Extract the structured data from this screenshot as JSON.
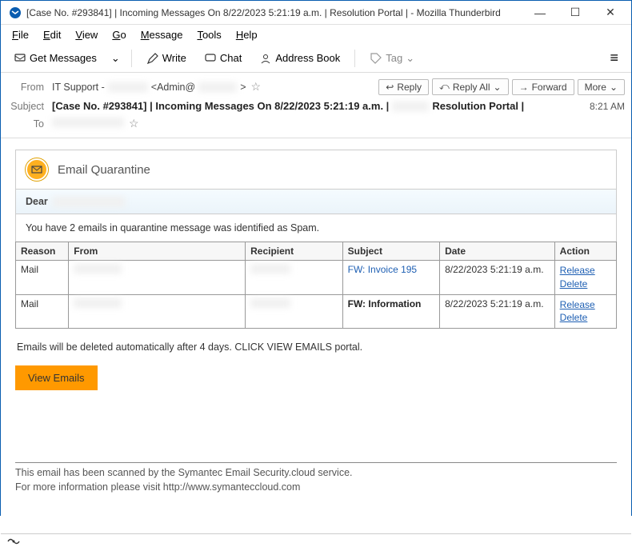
{
  "window": {
    "title": "[Case No. #293841] | Incoming Messages On 8/22/2023 5:21:19 a.m. |             Resolution Portal | - Mozilla Thunderbird"
  },
  "menu": [
    "File",
    "Edit",
    "View",
    "Go",
    "Message",
    "Tools",
    "Help"
  ],
  "toolbar": {
    "get_messages": "Get Messages",
    "write": "Write",
    "chat": "Chat",
    "address_book": "Address Book",
    "tag": "Tag"
  },
  "header": {
    "from_label": "From",
    "from_value": "IT Support -              <Admin@              >",
    "reply": "Reply",
    "reply_all": "Reply All",
    "forward": "Forward",
    "more": "More",
    "subject_label": "Subject",
    "subject_value": "[Case No. #293841] | Incoming Messages On 8/22/2023 5:21:19 a.m. |               Resolution Portal |",
    "time": "8:21 AM",
    "to_label": "To"
  },
  "body": {
    "quarantine_title": "Email Quarantine",
    "dear": "Dear",
    "intro": "You have 2 emails in quarantine message was identified as Spam.",
    "columns": [
      "Reason",
      "From",
      "Recipient",
      "Subject",
      "Date",
      "Action"
    ],
    "rows": [
      {
        "reason": "Mail",
        "from": "",
        "recipient": "",
        "subject": "FW: Invoice 195",
        "subject_style": "link",
        "date": "8/22/2023 5:21:19 a.m.",
        "actions": [
          "Release",
          "Delete"
        ]
      },
      {
        "reason": "Mail",
        "from": "",
        "recipient": "",
        "subject": "FW: Information",
        "subject_style": "bold",
        "date": "8/22/2023 5:21:19 a.m.",
        "actions": [
          "Release",
          "Delete"
        ]
      }
    ],
    "footer_msg": "Emails will be deleted automatically after 4 days. CLICK VIEW EMAILS portal.",
    "view_button": "View Emails",
    "sig1": "This email has been scanned by the Symantec Email Security.cloud service.",
    "sig2": "For more information please visit http://www.symanteccloud.com"
  },
  "status": {
    "icon": "((•))"
  }
}
